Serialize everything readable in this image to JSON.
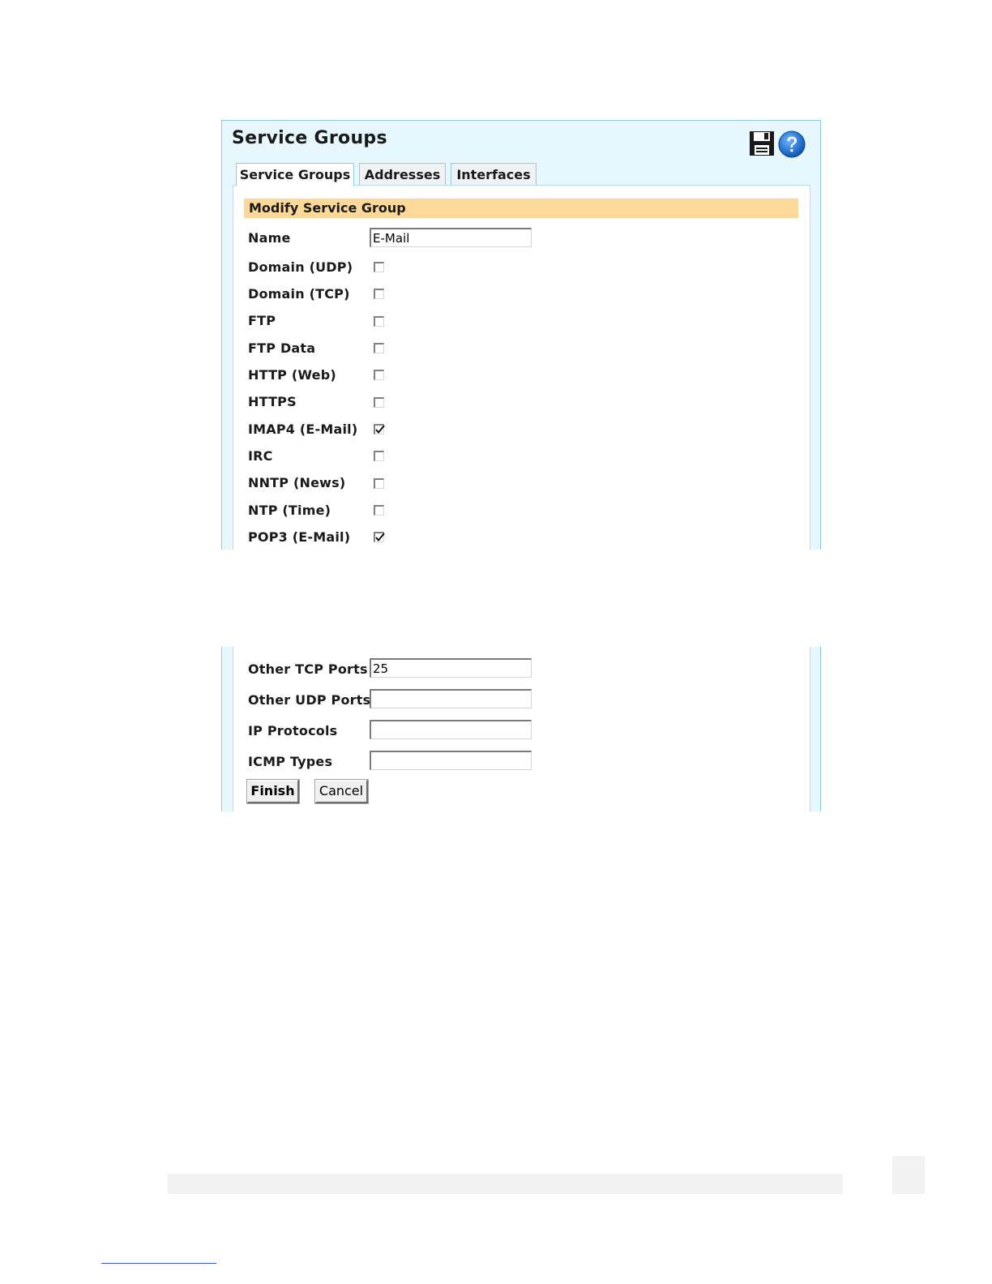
{
  "window": {
    "title": "Service Groups"
  },
  "toolbar": {
    "save_icon": "floppy-disk-icon",
    "help_icon": "question-mark-icon"
  },
  "tabs": [
    {
      "label": "Service Groups",
      "active": true
    },
    {
      "label": "Addresses",
      "active": false
    },
    {
      "label": "Interfaces",
      "active": false
    }
  ],
  "form": {
    "header": "Modify Service Group",
    "name_label": "Name",
    "name_value": "E-Mail",
    "services": [
      {
        "label": "Domain (UDP)",
        "checked": false
      },
      {
        "label": "Domain (TCP)",
        "checked": false
      },
      {
        "label": "FTP",
        "checked": false
      },
      {
        "label": "FTP Data",
        "checked": false
      },
      {
        "label": "HTTP (Web)",
        "checked": false
      },
      {
        "label": "HTTPS",
        "checked": false
      },
      {
        "label": "IMAP4 (E-Mail)",
        "checked": true
      },
      {
        "label": "IRC",
        "checked": false
      },
      {
        "label": "NNTP (News)",
        "checked": false
      },
      {
        "label": "NTP (Time)",
        "checked": false
      },
      {
        "label": "POP3 (E-Mail)",
        "checked": true
      }
    ],
    "ports": [
      {
        "label": "Other TCP Ports",
        "value": "25"
      },
      {
        "label": "Other UDP Ports",
        "value": ""
      },
      {
        "label": "IP Protocols",
        "value": ""
      },
      {
        "label": "ICMP Types",
        "value": ""
      }
    ],
    "finish_label": "Finish",
    "cancel_label": "Cancel"
  },
  "colors": {
    "panel_bg": "#e6f7fd",
    "panel_border": "#8ccbe8",
    "section_header_bg": "#fdd999"
  }
}
